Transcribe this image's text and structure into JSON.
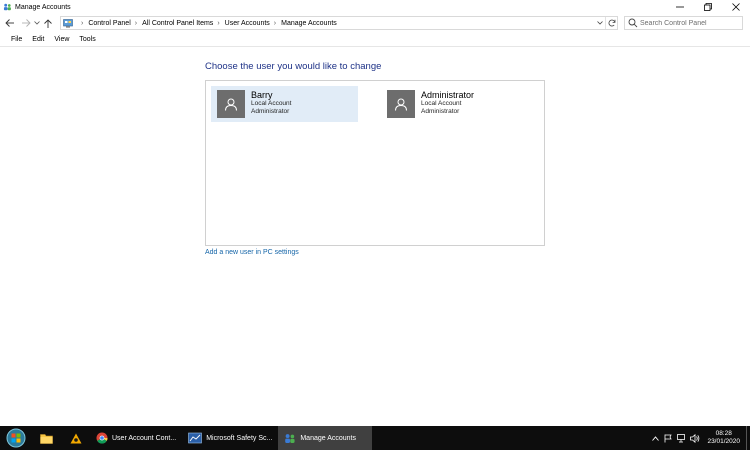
{
  "window": {
    "title": "Manage Accounts"
  },
  "navigation": {
    "breadcrumbs": [
      "Control Panel",
      "All Control Panel Items",
      "User Accounts",
      "Manage Accounts"
    ],
    "search_placeholder": "Search Control Panel"
  },
  "menu": [
    "File",
    "Edit",
    "View",
    "Tools"
  ],
  "main": {
    "heading": "Choose the user you would like to change",
    "accounts": [
      {
        "name": "Barry",
        "type": "Local Account",
        "role": "Administrator",
        "selected": true
      },
      {
        "name": "Administrator",
        "type": "Local Account",
        "role": "Administrator",
        "selected": false
      }
    ],
    "add_user_link": "Add a new user in PC settings"
  },
  "taskbar": {
    "tasks": [
      {
        "label": "User Account Cont...",
        "icon": "chrome-icon"
      },
      {
        "label": "Microsoft Safety Sc...",
        "icon": "safety-scanner-icon"
      },
      {
        "label": "Manage Accounts",
        "icon": "user-accounts-icon",
        "active": true
      }
    ],
    "clock": {
      "time": "08:28",
      "date": "23/01/2020"
    }
  }
}
